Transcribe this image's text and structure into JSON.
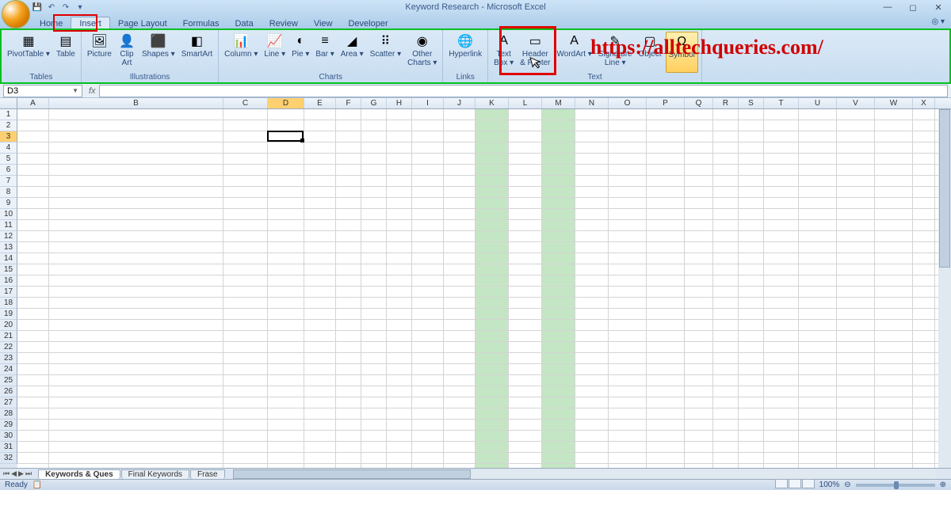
{
  "title": "Keyword Research - Microsoft Excel",
  "overlay_url": "https://alltechqueries.com/",
  "qat": {
    "save": "💾",
    "undo": "↶",
    "redo": "↷"
  },
  "tabs": {
    "items": [
      "Home",
      "Insert",
      "Page Layout",
      "Formulas",
      "Data",
      "Review",
      "View",
      "Developer"
    ],
    "active": 1
  },
  "ribbon": {
    "groups": [
      {
        "label": "Tables",
        "items": [
          {
            "name": "pivottable",
            "label": "PivotTable",
            "icon": "▦",
            "dd": true
          },
          {
            "name": "table",
            "label": "Table",
            "icon": "▤"
          }
        ]
      },
      {
        "label": "Illustrations",
        "items": [
          {
            "name": "picture",
            "label": "Picture",
            "icon": "🖼"
          },
          {
            "name": "clipart",
            "label": "Clip\nArt",
            "icon": "👤"
          },
          {
            "name": "shapes",
            "label": "Shapes",
            "icon": "⬛",
            "dd": true
          },
          {
            "name": "smartart",
            "label": "SmartArt",
            "icon": "◧"
          }
        ]
      },
      {
        "label": "Charts",
        "items": [
          {
            "name": "column",
            "label": "Column",
            "icon": "📊",
            "dd": true
          },
          {
            "name": "line",
            "label": "Line",
            "icon": "📈",
            "dd": true
          },
          {
            "name": "pie",
            "label": "Pie",
            "icon": "◐",
            "dd": true
          },
          {
            "name": "bar",
            "label": "Bar",
            "icon": "≡",
            "dd": true
          },
          {
            "name": "area",
            "label": "Area",
            "icon": "◢",
            "dd": true
          },
          {
            "name": "scatter",
            "label": "Scatter",
            "icon": "⠿",
            "dd": true
          },
          {
            "name": "other-charts",
            "label": "Other\nCharts",
            "icon": "◉",
            "dd": true
          }
        ]
      },
      {
        "label": "Links",
        "items": [
          {
            "name": "hyperlink",
            "label": "Hyperlink",
            "icon": "🌐"
          }
        ]
      },
      {
        "label": "Text",
        "items": [
          {
            "name": "textbox",
            "label": "Text\nBox",
            "icon": "A",
            "dd": true
          },
          {
            "name": "headerfooter",
            "label": "Header\n& Footer",
            "icon": "▭"
          },
          {
            "name": "wordart",
            "label": "WordArt",
            "icon": "A",
            "dd": true
          },
          {
            "name": "signature",
            "label": "Signature\nLine",
            "icon": "✎",
            "dd": true
          },
          {
            "name": "object",
            "label": "Object",
            "icon": "▢"
          },
          {
            "name": "symbol",
            "label": "Symbol",
            "icon": "Ω",
            "highlighted": true
          }
        ]
      }
    ]
  },
  "name_box": "D3",
  "columns": [
    "A",
    "B",
    "C",
    "D",
    "E",
    "F",
    "G",
    "H",
    "I",
    "J",
    "K",
    "L",
    "M",
    "N",
    "O",
    "P",
    "Q",
    "R",
    "S",
    "T",
    "U",
    "V",
    "W",
    "X"
  ],
  "col_widths": {
    "A": 40,
    "B": 220,
    "C": 56,
    "D": 46,
    "E": 40,
    "F": 32,
    "G": 32,
    "H": 32,
    "I": 40,
    "J": 40,
    "K": 42,
    "L": 42,
    "M": 42,
    "N": 42,
    "O": 48,
    "P": 48,
    "Q": 36,
    "R": 32,
    "S": 32,
    "T": 44,
    "U": 48,
    "V": 48,
    "W": 48,
    "X": 28
  },
  "highlighted_cols": [
    "K",
    "M"
  ],
  "active_cell": {
    "ref": "D3",
    "col": "D",
    "row": 3
  },
  "row_count": 32,
  "sheets": {
    "items": [
      "Keywords & Ques",
      "Final Keywords",
      "Frase"
    ],
    "active": 0
  },
  "status": {
    "left": "Ready",
    "zoom": "100%"
  }
}
